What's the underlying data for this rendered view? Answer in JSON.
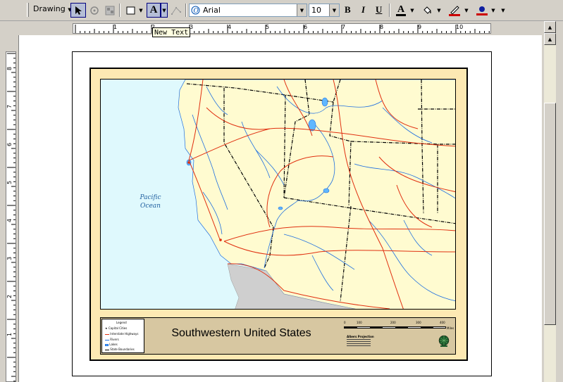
{
  "toolbar": {
    "drawing_label": "Drawing",
    "font_name": "Arial",
    "font_size": "10",
    "bold_label": "B",
    "italic_label": "I",
    "underline_label": "U",
    "font_color_label": "A",
    "text_tool_label": "A",
    "tooltip": "New Text",
    "colors": {
      "font_color": "#000000",
      "line_color": "#cc0000",
      "marker_color": "#cc0000",
      "fill_color": "#ffff00"
    }
  },
  "rulers": {
    "horizontal": [
      "1",
      "2",
      "3",
      "4",
      "5",
      "6",
      "7",
      "8",
      "9",
      "10"
    ],
    "vertical": [
      "8",
      "7",
      "6",
      "5",
      "4",
      "3",
      "2",
      "1"
    ]
  },
  "map": {
    "ocean_label_line1": "Pacific",
    "ocean_label_line2": "Ocean",
    "title": "Southwestern United States",
    "legend_title": "Legend",
    "legend_items": [
      "Capital Cities",
      "Interstate Highways",
      "Rivers",
      "Lakes",
      "State Boundaries"
    ],
    "scale_ticks": [
      "0",
      "100",
      "200",
      "300",
      "400",
      "500"
    ],
    "scale_unit": "Miles",
    "projection_label": "Albers Projection",
    "colors": {
      "land": "#fffbd0",
      "ocean": "#dff9fd",
      "frame": "#fde9b3",
      "legend_bar": "#d7c7a1",
      "mexico": "#cfcfcf",
      "roads": "#e03010",
      "rivers": "#1f6fe0"
    }
  }
}
